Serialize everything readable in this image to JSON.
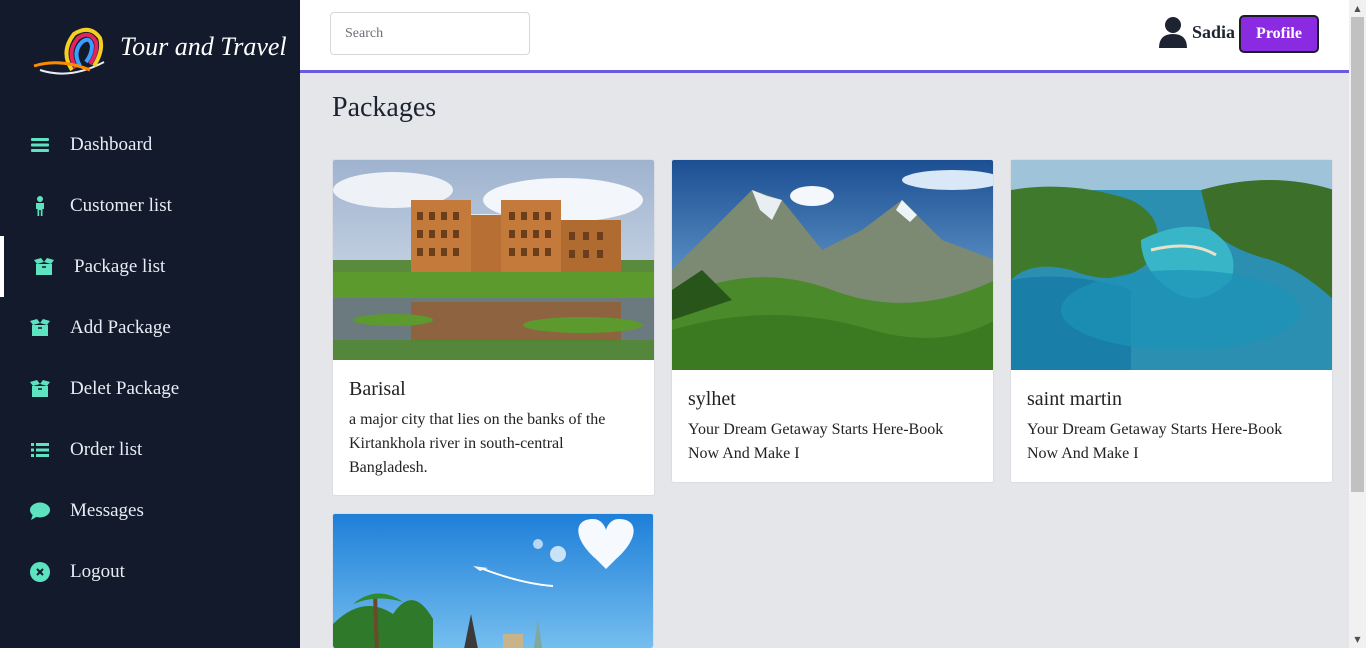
{
  "brand": {
    "name": "Tour and Travel"
  },
  "sidebar": {
    "items": [
      {
        "label": "Dashboard",
        "icon": "bars-icon"
      },
      {
        "label": "Customer list",
        "icon": "person-icon"
      },
      {
        "label": "Package list",
        "icon": "box-icon",
        "active": true
      },
      {
        "label": "Add Package",
        "icon": "box-icon"
      },
      {
        "label": "Delet Package",
        "icon": "box-icon"
      },
      {
        "label": "Order list",
        "icon": "list-icon"
      },
      {
        "label": "Messages",
        "icon": "chat-icon"
      },
      {
        "label": "Logout",
        "icon": "close-circle-icon"
      }
    ]
  },
  "header": {
    "search_placeholder": "Search",
    "user_name": "Sadia",
    "profile_label": "Profile"
  },
  "main": {
    "title": "Packages",
    "packages": [
      {
        "title": "Barisal",
        "description": "a major city that lies on the banks of the Kirtankhola river in south-central Bangladesh."
      },
      {
        "title": "sylhet",
        "description": "Your Dream Getaway Starts Here-Book Now And Make I"
      },
      {
        "title": "saint martin",
        "description": "Your Dream Getaway Starts Here-Book Now And Make I"
      }
    ]
  },
  "colors": {
    "sidebar_bg": "#121a2b",
    "icon_accent": "#5de3c0",
    "header_border": "#6a5ae0",
    "profile_button": "#8a2be2",
    "page_bg": "#e5e6ea"
  }
}
